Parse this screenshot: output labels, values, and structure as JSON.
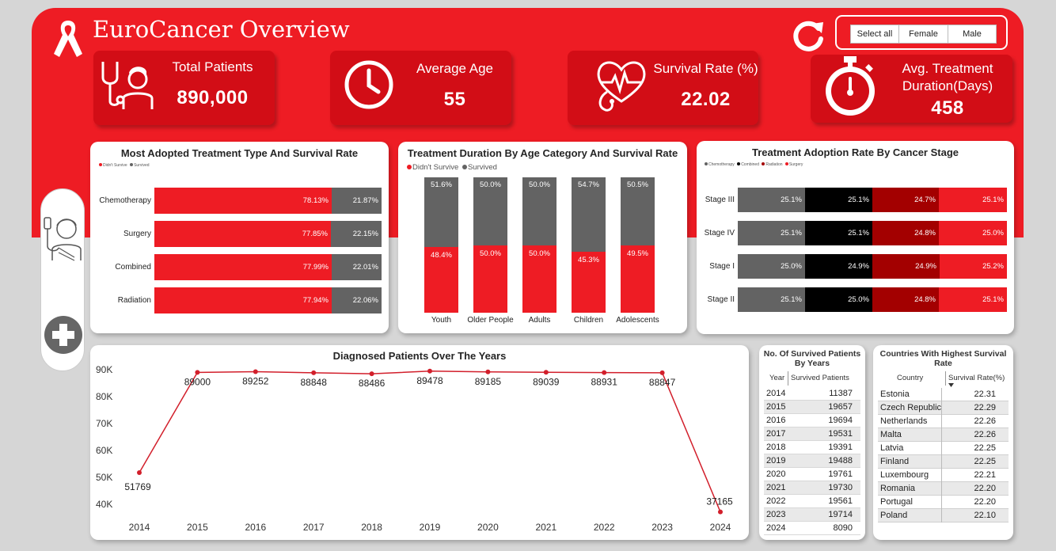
{
  "header": {
    "title": "EuroCancer Overview"
  },
  "slicer": {
    "options": [
      "Select all",
      "Female",
      "Male"
    ]
  },
  "kpis": [
    {
      "label": "Total Patients",
      "value": "890,000",
      "icon": "doctor-stethoscope-icon"
    },
    {
      "label": "Average Age",
      "value": "55",
      "icon": "clock-icon"
    },
    {
      "label": "Survival Rate (%)",
      "value": "22.02",
      "icon": "heart-pulse-icon"
    },
    {
      "label": "Avg. Treatment Duration(Days)",
      "label_lines": [
        "Avg. Treatment",
        "Duration(Days)"
      ],
      "value": "458",
      "icon": "stopwatch-icon"
    }
  ],
  "colors": {
    "red": "#ee1c24",
    "dark_red": "#a30000",
    "grey": "#636363",
    "black": "#000000"
  },
  "chart_data": [
    {
      "type": "bar",
      "title": "Most Adopted Treatment Type And Survival Rate",
      "legend": [
        "Didn't Survive",
        "Survived"
      ],
      "categories": [
        "Chemotherapy",
        "Surgery",
        "Combined",
        "Radiation"
      ],
      "series": [
        {
          "name": "Didn't Survive",
          "values": [
            78.13,
            77.85,
            77.99,
            77.94
          ]
        },
        {
          "name": "Survived",
          "values": [
            21.87,
            22.15,
            22.01,
            22.06
          ]
        }
      ],
      "labels": [
        [
          "78.13%",
          "21.87%"
        ],
        [
          "77.85%",
          "22.15%"
        ],
        [
          "77.99%",
          "22.01%"
        ],
        [
          "77.94%",
          "22.06%"
        ]
      ]
    },
    {
      "type": "bar",
      "title": "Treatment Duration By Age Category And Survival Rate",
      "legend": [
        "Didn't Survive",
        "Survived"
      ],
      "categories": [
        "Youth",
        "Older People",
        "Adults",
        "Children",
        "Adolescents"
      ],
      "series": [
        {
          "name": "Didn't Survive",
          "values": [
            48.4,
            50.0,
            50.0,
            45.3,
            49.5
          ]
        },
        {
          "name": "Survived",
          "values": [
            51.6,
            50.0,
            50.0,
            54.7,
            50.5
          ]
        }
      ],
      "labels": [
        [
          "48.4%",
          "51.6%"
        ],
        [
          "50.0%",
          "50.0%"
        ],
        [
          "50.0%",
          "50.0%"
        ],
        [
          "45.3%",
          "54.7%"
        ],
        [
          "49.5%",
          "50.5%"
        ]
      ]
    },
    {
      "type": "bar",
      "title": "Treatment Adoption Rate By Cancer Stage",
      "legend": [
        "Chemotherapy",
        "Combined",
        "Radiation",
        "Surgery"
      ],
      "categories": [
        "Stage III",
        "Stage IV",
        "Stage I",
        "Stage II"
      ],
      "series": [
        {
          "name": "Chemotherapy",
          "values": [
            25.1,
            25.1,
            25.0,
            25.1
          ]
        },
        {
          "name": "Combined",
          "values": [
            25.1,
            25.1,
            24.9,
            25.0
          ]
        },
        {
          "name": "Radiation",
          "values": [
            24.7,
            24.8,
            24.9,
            24.8
          ]
        },
        {
          "name": "Surgery",
          "values": [
            25.1,
            25.0,
            25.2,
            25.1
          ]
        }
      ],
      "labels": [
        [
          "25.1%",
          "25.1%",
          "24.7%",
          "25.1%"
        ],
        [
          "25.1%",
          "25.1%",
          "24.8%",
          "25.0%"
        ],
        [
          "25.0%",
          "24.9%",
          "24.9%",
          "25.2%"
        ],
        [
          "25.1%",
          "25.0%",
          "24.8%",
          "25.1%"
        ]
      ]
    },
    {
      "type": "line",
      "title": "Diagnosed Patients Over The Years",
      "x": [
        2014,
        2015,
        2016,
        2017,
        2018,
        2019,
        2020,
        2021,
        2022,
        2023,
        2024
      ],
      "y": [
        51769,
        89000,
        89252,
        88848,
        88486,
        89478,
        89185,
        89039,
        88931,
        88847,
        37165
      ],
      "y_ticks": [
        "90K",
        "80K",
        "70K",
        "60K",
        "50K",
        "40K"
      ],
      "ylim": [
        37000,
        90800
      ]
    }
  ],
  "survived_table": {
    "title": "No. Of Survived Patients By Years",
    "title_lines": [
      "No. Of Survived Patients",
      "By Years"
    ],
    "columns": [
      "Year",
      "Survived Patients"
    ],
    "rows": [
      [
        "2014",
        "11387"
      ],
      [
        "2015",
        "19657"
      ],
      [
        "2016",
        "19694"
      ],
      [
        "2017",
        "19531"
      ],
      [
        "2018",
        "19391"
      ],
      [
        "2019",
        "19488"
      ],
      [
        "2020",
        "19761"
      ],
      [
        "2021",
        "19730"
      ],
      [
        "2022",
        "19561"
      ],
      [
        "2023",
        "19714"
      ],
      [
        "2024",
        "8090"
      ]
    ]
  },
  "countries_table": {
    "title": "Countries With Highest Survival Rate",
    "title_lines": [
      "Countries With Highest Survival",
      "Rate"
    ],
    "columns": [
      "Country",
      "Survival Rate(%)"
    ],
    "rows": [
      [
        "Estonia",
        "22.31"
      ],
      [
        "Czech Republic",
        "22.29"
      ],
      [
        "Netherlands",
        "22.26"
      ],
      [
        "Malta",
        "22.26"
      ],
      [
        "Latvia",
        "22.25"
      ],
      [
        "Finland",
        "22.25"
      ],
      [
        "Luxembourg",
        "22.21"
      ],
      [
        "Romania",
        "22.20"
      ],
      [
        "Portugal",
        "22.20"
      ],
      [
        "Poland",
        "22.10"
      ]
    ]
  }
}
